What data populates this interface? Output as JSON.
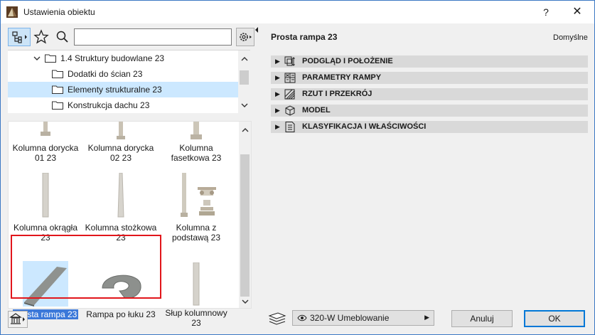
{
  "window": {
    "title": "Ustawienia obiektu",
    "help": "?",
    "close": "✕"
  },
  "tree": {
    "items": [
      {
        "label": "1.4 Struktury budowlane 23",
        "expanded": true,
        "selected": false
      },
      {
        "label": "Dodatki do ścian 23",
        "selected": false
      },
      {
        "label": "Elementy strukturalne 23",
        "selected": true
      },
      {
        "label": "Konstrukcja dachu 23",
        "selected": false
      }
    ]
  },
  "library": {
    "items": [
      {
        "line1": "Kolumna dorycka",
        "line2": "01 23"
      },
      {
        "line1": "Kolumna dorycka",
        "line2": "02 23"
      },
      {
        "line1": "Kolumna",
        "line2": "fasetkowa 23"
      },
      {
        "line1": "Kolumna okrągła",
        "line2": "23"
      },
      {
        "line1": "Kolumna stożkowa",
        "line2": "23"
      },
      {
        "line1": "Kolumna z",
        "line2": "podstawą 23"
      },
      {
        "line1": "Prosta rampa 23",
        "line2": "",
        "selected": true
      },
      {
        "line1": "Rampa po łuku 23",
        "line2": ""
      },
      {
        "line1": "Słup kolumnowy",
        "line2": "23"
      }
    ]
  },
  "object": {
    "title": "Prosta rampa 23",
    "default_label": "Domyślne"
  },
  "panels": [
    {
      "label": "PODGLĄD I POŁOŻENIE"
    },
    {
      "label": "PARAMETRY RAMPY"
    },
    {
      "label": "RZUT I PRZEKRÓJ"
    },
    {
      "label": "MODEL"
    },
    {
      "label": "KLASYFIKACJA I WŁAŚCIWOŚCI"
    }
  ],
  "footer": {
    "layer": "320-W Umeblowanie",
    "cancel": "Anuluj",
    "ok": "OK"
  },
  "colors": {
    "accent": "#3b78d9",
    "selection_bg": "#cce8ff",
    "highlight_border": "#e1161b"
  }
}
